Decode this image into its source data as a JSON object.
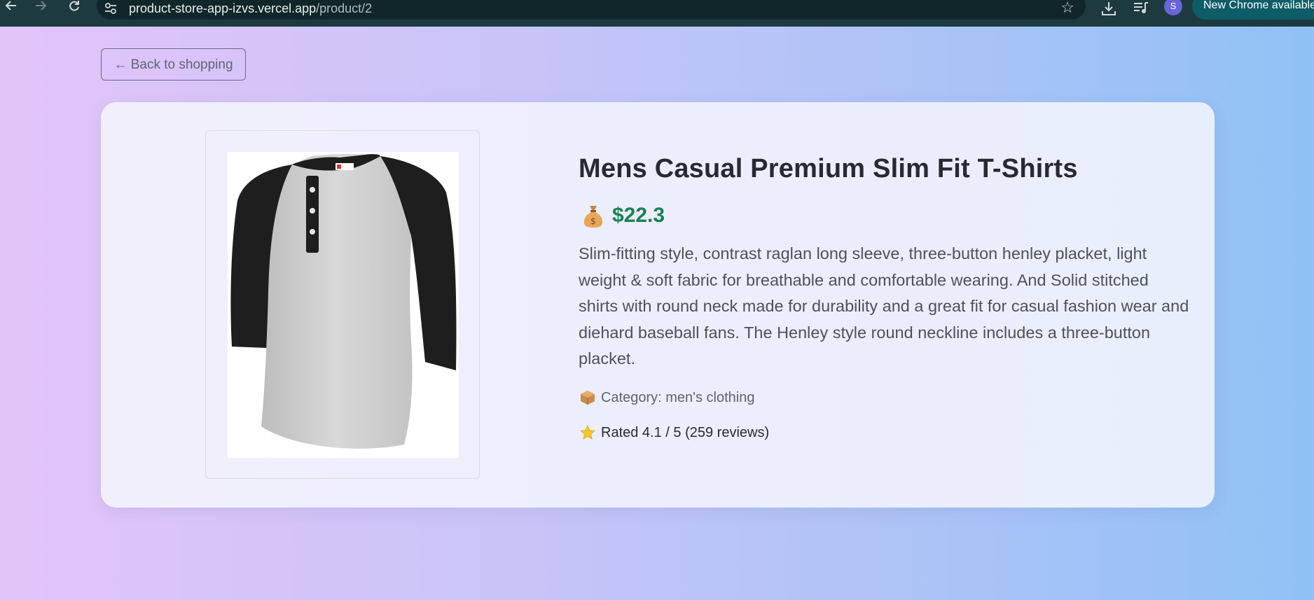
{
  "browser": {
    "url_host": "product-store-app-izvs.vercel.app",
    "url_path": "/product/2",
    "profile_initial": "S",
    "update_label": "New Chrome available"
  },
  "icons": {
    "back": "arrow-left-icon",
    "forward": "arrow-right-icon",
    "reload": "reload-icon",
    "site_info": "tune-icon",
    "bookmark": "star-outline-icon",
    "download": "download-icon",
    "media": "queue-music-icon",
    "price": "money-bag-icon",
    "category": "package-icon",
    "rating": "star-icon"
  },
  "page": {
    "back_label": "← Back to shopping"
  },
  "product": {
    "title": "Mens Casual Premium Slim Fit T-Shirts",
    "price": "$22.3",
    "description": "Slim-fitting style, contrast raglan long sleeve, three-button henley placket, light weight & soft fabric for breathable and comfortable wearing. And Solid stitched shirts with round neck made for durability and a great fit for casual fashion wear and diehard baseball fans. The Henley style round neckline includes a three-button placket.",
    "category_text": "Category: men's clothing",
    "rating_text": "Rated 4.1 / 5 (259 reviews)",
    "rating_value": 4.1,
    "rating_max": 5,
    "review_count": 259
  },
  "colors": {
    "price_green": "#1a8254",
    "title": "#262a33",
    "chrome_bg": "#1d3a3f"
  }
}
